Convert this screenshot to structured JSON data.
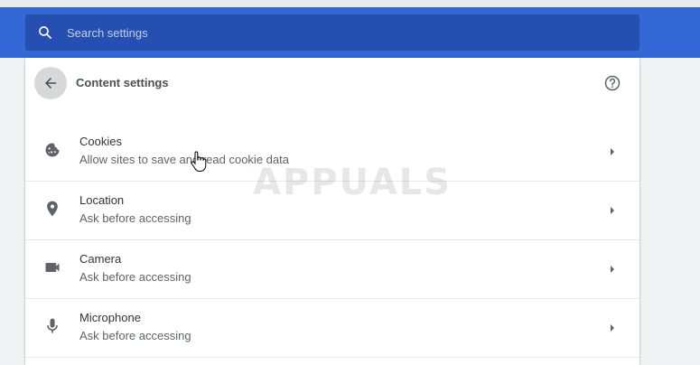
{
  "search": {
    "placeholder": "Search settings",
    "icon": "search-icon"
  },
  "page": {
    "title": "Content settings",
    "back_icon": "arrow-back-icon",
    "help_icon": "help-icon"
  },
  "items": [
    {
      "title": "Cookies",
      "subtitle": "Allow sites to save and read cookie data",
      "icon": "cookie-icon"
    },
    {
      "title": "Location",
      "subtitle": "Ask before accessing",
      "icon": "location-pin-icon"
    },
    {
      "title": "Camera",
      "subtitle": "Ask before accessing",
      "icon": "camera-icon"
    },
    {
      "title": "Microphone",
      "subtitle": "Ask before accessing",
      "icon": "microphone-icon"
    }
  ],
  "watermark": {
    "text": "APPUALS"
  },
  "colors": {
    "header_blue": "#3367d6",
    "searchbar_blue": "#254fb0",
    "icon_gray": "#5f6368"
  }
}
